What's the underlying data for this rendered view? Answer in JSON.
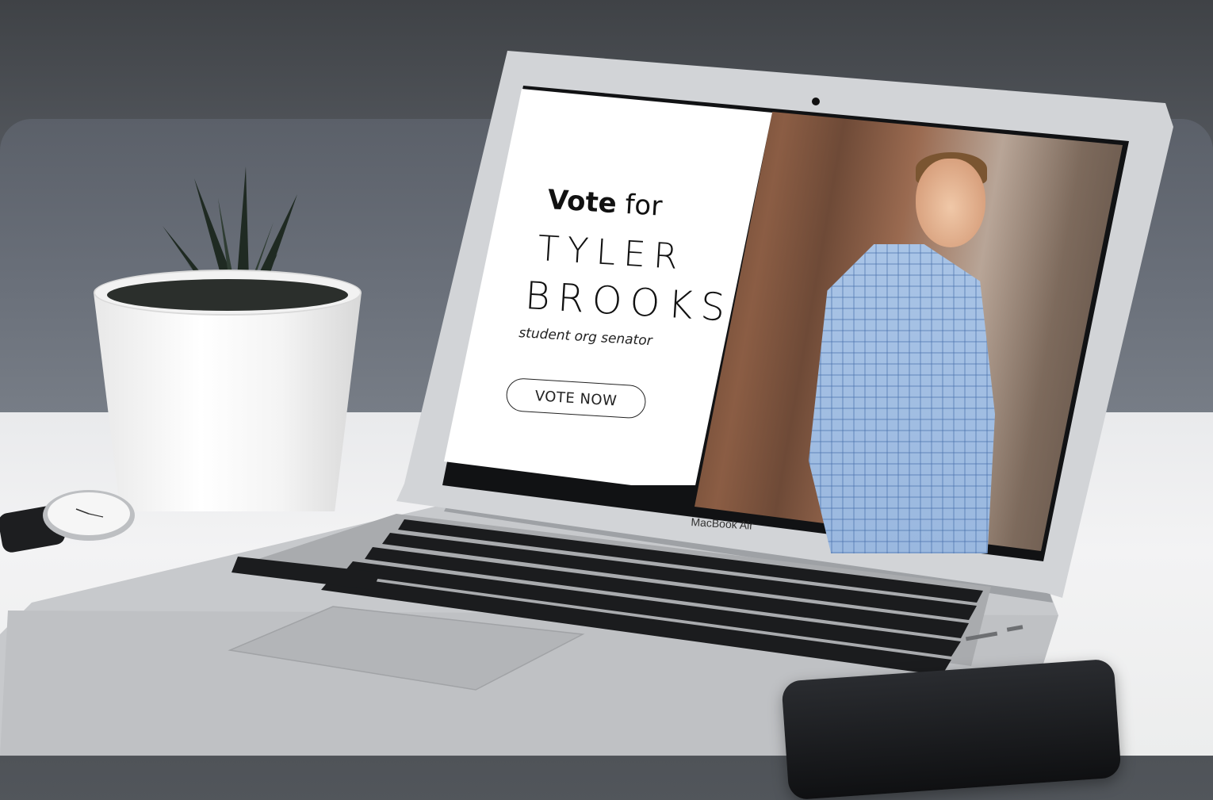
{
  "screen": {
    "headline_bold": "Vote",
    "headline_rest": "for",
    "first_name": "TYLER",
    "last_name": "BROOKS",
    "subtitle": "student org senator",
    "cta_button": "VOTE NOW"
  },
  "device": {
    "brand_label": "MacBook Air"
  },
  "colors": {
    "screen_background": "#ffffff",
    "text": "#111111",
    "laptop_body": "#c9cbce",
    "keys": "#1b1c1e"
  },
  "icons": [
    "camera-icon",
    "plant-icon",
    "watch-icon",
    "phone-icon"
  ]
}
